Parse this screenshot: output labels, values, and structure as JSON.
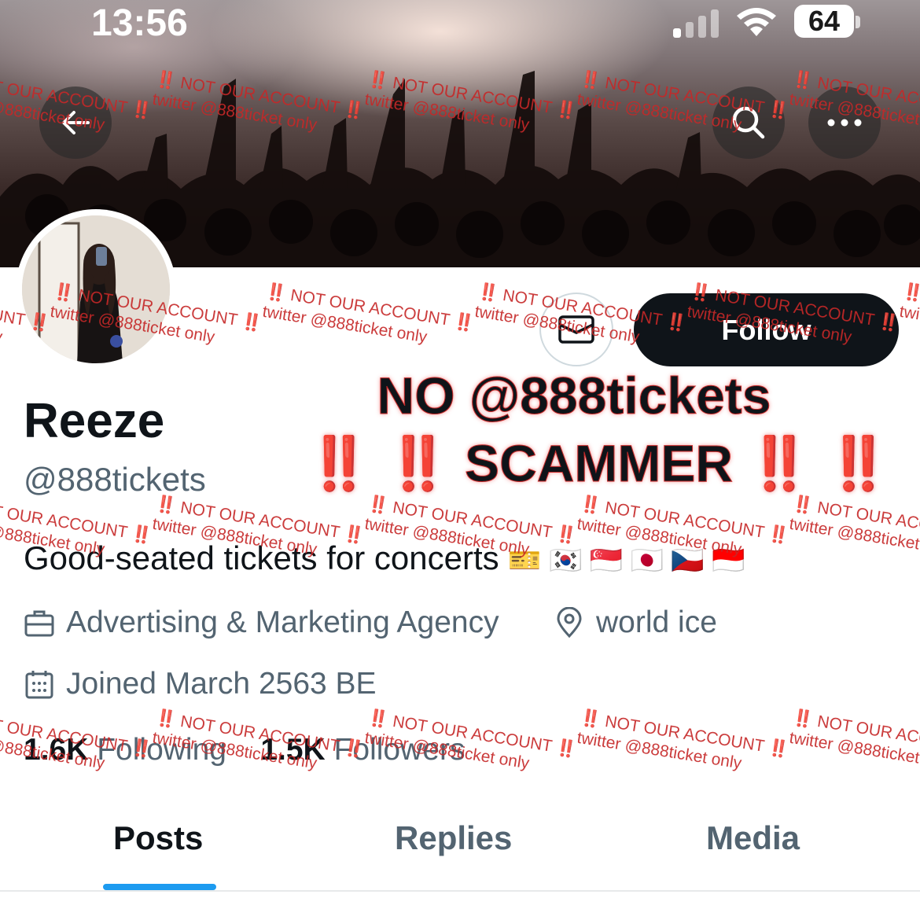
{
  "status_bar": {
    "time": "13:56",
    "battery": "64"
  },
  "profile": {
    "name": "Reeze",
    "handle": "@888tickets",
    "bio": "Good-seated tickets for concerts",
    "bio_emojis": "🎫 🇰🇷 🇸🇬 🇯🇵 🇨🇿 🇮🇩",
    "category": "Advertising & Marketing Agency",
    "location": "world ice",
    "joined": "Joined March 2563 BE",
    "following_count": "1.6K",
    "following_label": "Following",
    "followers_count": "1.5K",
    "followers_label": "Followers"
  },
  "actions": {
    "follow_label": "Follow"
  },
  "tabs": [
    {
      "label": "Posts",
      "active": true
    },
    {
      "label": "Replies",
      "active": false
    },
    {
      "label": "Media",
      "active": false
    }
  ],
  "overlay": {
    "warning_line1": "NO @888tickets",
    "warning_bangs_left": "‼️ ‼️",
    "warning_line2": "SCAMMER",
    "warning_bangs_right": "‼️ ‼️",
    "watermark_line1": "‼️ NOT OUR ACCOUNT ‼️",
    "watermark_line2": "twitter @888ticket only"
  },
  "icons": {
    "back": "arrow-left-icon",
    "search": "search-icon",
    "more": "more-horizontal-icon",
    "message": "envelope-icon",
    "category": "briefcase-icon",
    "location": "location-pin-icon",
    "joined": "calendar-icon"
  },
  "colors": {
    "accent": "#1d9bf0",
    "watermark": "#c62828",
    "follow_bg": "#0f1419",
    "secondary_text": "#536471"
  }
}
